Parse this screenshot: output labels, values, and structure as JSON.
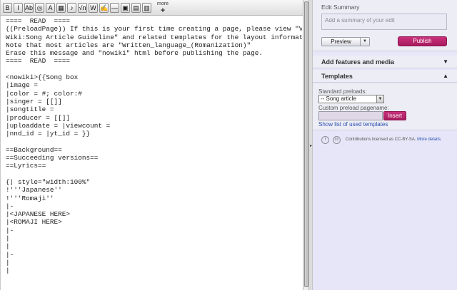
{
  "toolbar": {
    "buttons": [
      {
        "name": "bold-button",
        "glyph": "B"
      },
      {
        "name": "italic-button",
        "glyph": "I"
      },
      {
        "name": "internal-link-button",
        "glyph": "Ab"
      },
      {
        "name": "external-link-button",
        "glyph": "◎"
      },
      {
        "name": "heading-button",
        "glyph": "A"
      },
      {
        "name": "image-button",
        "glyph": "▦"
      },
      {
        "name": "media-button",
        "glyph": "♪"
      },
      {
        "name": "math-button",
        "glyph": "√n"
      },
      {
        "name": "nowiki-button",
        "glyph": "W"
      },
      {
        "name": "signature-button",
        "glyph": "✍"
      },
      {
        "name": "horizontal-line-button",
        "glyph": "—"
      },
      {
        "name": "gallery-button",
        "glyph": "▣"
      },
      {
        "name": "template-button",
        "glyph": "▤"
      },
      {
        "name": "table-button",
        "glyph": "▥"
      }
    ],
    "more_label": "more",
    "more_plus": "+"
  },
  "editor": {
    "text": "====  READ  ====\n((PreloadPage)) If this is your first time creating a page, please view \"Vocaloid\nWiki:Song Article Guideline\" and related templates for the layout information.\nNote that most articles are \"Written_language_(Romanization)\"\nErase this message and \"nowiki\" html before publishing the page.\n====  READ  ====\n\n<nowiki>{{Song box\n|image =\n|color = #; color:#\n|singer = [[]]\n|songtitle =\n|producer = [[]]\n|uploaddate = |viewcount =\n|nnd_id = |yt_id = }}\n\n==Background==\n==Succeeding versions==\n==Lyrics==\n\n{| style=\"width:100%\"\n!'''Japanese''\n!'''Romaji''\n|-\n|<JAPANESE HERE>\n|<ROMAJI HERE>\n|-\n|\n|\n|-\n|\n|"
  },
  "summary": {
    "title": "Edit Summary",
    "placeholder": "Add a summary of your edit",
    "preview_label": "Preview",
    "publish_label": "Publish"
  },
  "sections": {
    "features_label": "Add features and media",
    "templates_label": "Templates"
  },
  "templates": {
    "standard_label": "Standard preloads:",
    "selected": "-- Song article",
    "custom_label": "Custom preload pagename:",
    "insert_label": "Insert",
    "show_list_link": "Show list of used templates"
  },
  "license": {
    "text": "Contributions licensed as CC-BY-SA.",
    "more_link": "More details."
  },
  "colors": {
    "panel_bg": "#e6e6f8",
    "accent": "#b82468",
    "link": "#2a4fb0"
  }
}
